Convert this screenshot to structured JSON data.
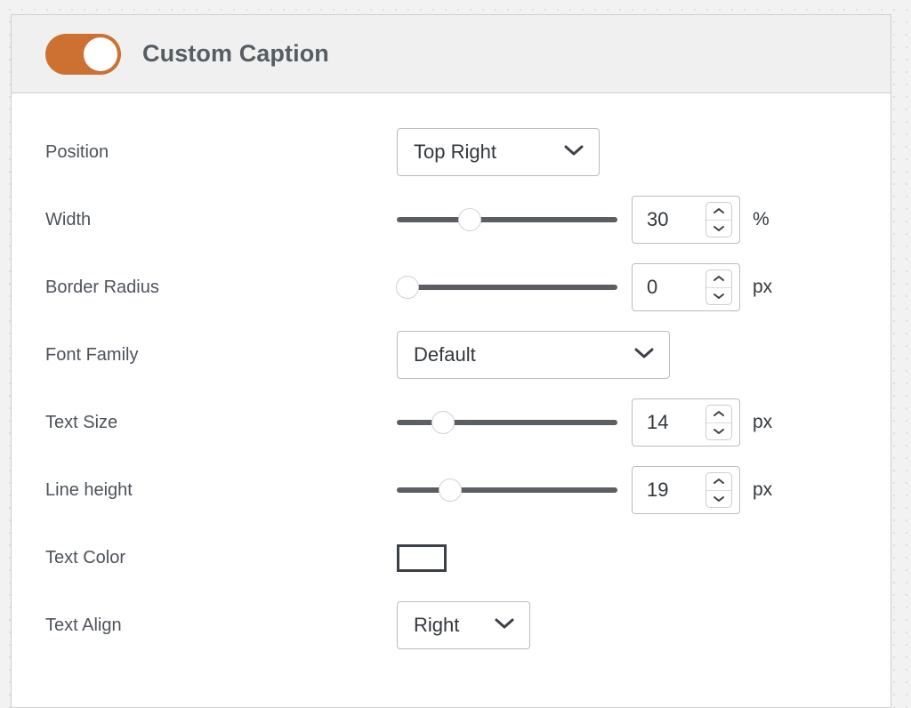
{
  "panel": {
    "title": "Custom Caption",
    "toggle": {
      "name": "custom-caption-toggle",
      "state": "on",
      "color": "#cc7132"
    }
  },
  "rows": [
    {
      "label": "Position",
      "type": "select",
      "value": "Top Right"
    },
    {
      "label": "Width",
      "type": "slider",
      "value": "30",
      "unit": "%",
      "percent": 33
    },
    {
      "label": "Border Radius",
      "type": "slider",
      "value": "0",
      "unit": "px",
      "percent": 5
    },
    {
      "label": "Font Family",
      "type": "select",
      "value": "Default"
    },
    {
      "label": "Text Size",
      "type": "slider",
      "value": "14",
      "unit": "px",
      "percent": 21
    },
    {
      "label": "Line height",
      "type": "slider",
      "value": "19",
      "unit": "px",
      "percent": 24
    },
    {
      "label": "Text Color",
      "type": "color",
      "value": "#ffffff"
    },
    {
      "label": "Text Align",
      "type": "select",
      "value": "Right"
    }
  ],
  "icons": {
    "chevron_down": "chevron-down-icon",
    "spinner_up": "spinner-up-icon",
    "spinner_down": "spinner-down-icon"
  }
}
